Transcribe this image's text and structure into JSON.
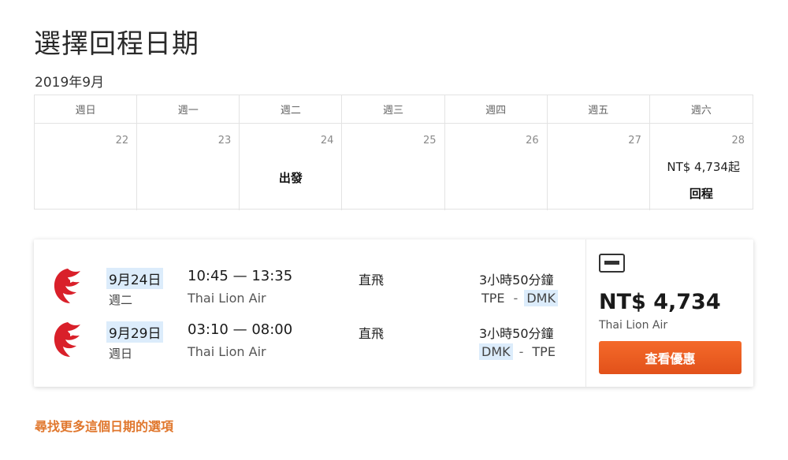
{
  "page": {
    "title": "選擇回程日期",
    "month": "2019年9月"
  },
  "calendar": {
    "weekdays": [
      "週日",
      "週一",
      "週二",
      "週三",
      "週四",
      "週五",
      "週六"
    ],
    "days": [
      {
        "num": "22"
      },
      {
        "num": "23"
      },
      {
        "num": "24",
        "mark": "出發"
      },
      {
        "num": "25"
      },
      {
        "num": "26"
      },
      {
        "num": "27"
      },
      {
        "num": "28",
        "price": "NT$ 4,734起",
        "mark": "回程"
      }
    ]
  },
  "result": {
    "legs": [
      {
        "date": "9月24日",
        "weekday": "週二",
        "times": "10:45 — 13:35",
        "airline": "Thai Lion Air",
        "stops": "直飛",
        "duration": "3小時50分鐘",
        "from": "TPE",
        "to": "DMK"
      },
      {
        "date": "9月29日",
        "weekday": "週日",
        "times": "03:10 — 08:00",
        "airline": "Thai Lion Air",
        "stops": "直飛",
        "duration": "3小時50分鐘",
        "from": "DMK",
        "to": "TPE"
      }
    ],
    "price": "NT$ 4,734",
    "price_airline": "Thai Lion Air",
    "deal_label": "查看優惠",
    "icons": {
      "airline_logo": "lion-air-logo",
      "card": "credit-card-icon"
    }
  },
  "links": {
    "more": "尋找更多這個日期的選項"
  },
  "colors": {
    "accent": "#e2511a",
    "highlight": "#dcecfb",
    "link": "#e0772d",
    "logo_red": "#d9202a"
  }
}
